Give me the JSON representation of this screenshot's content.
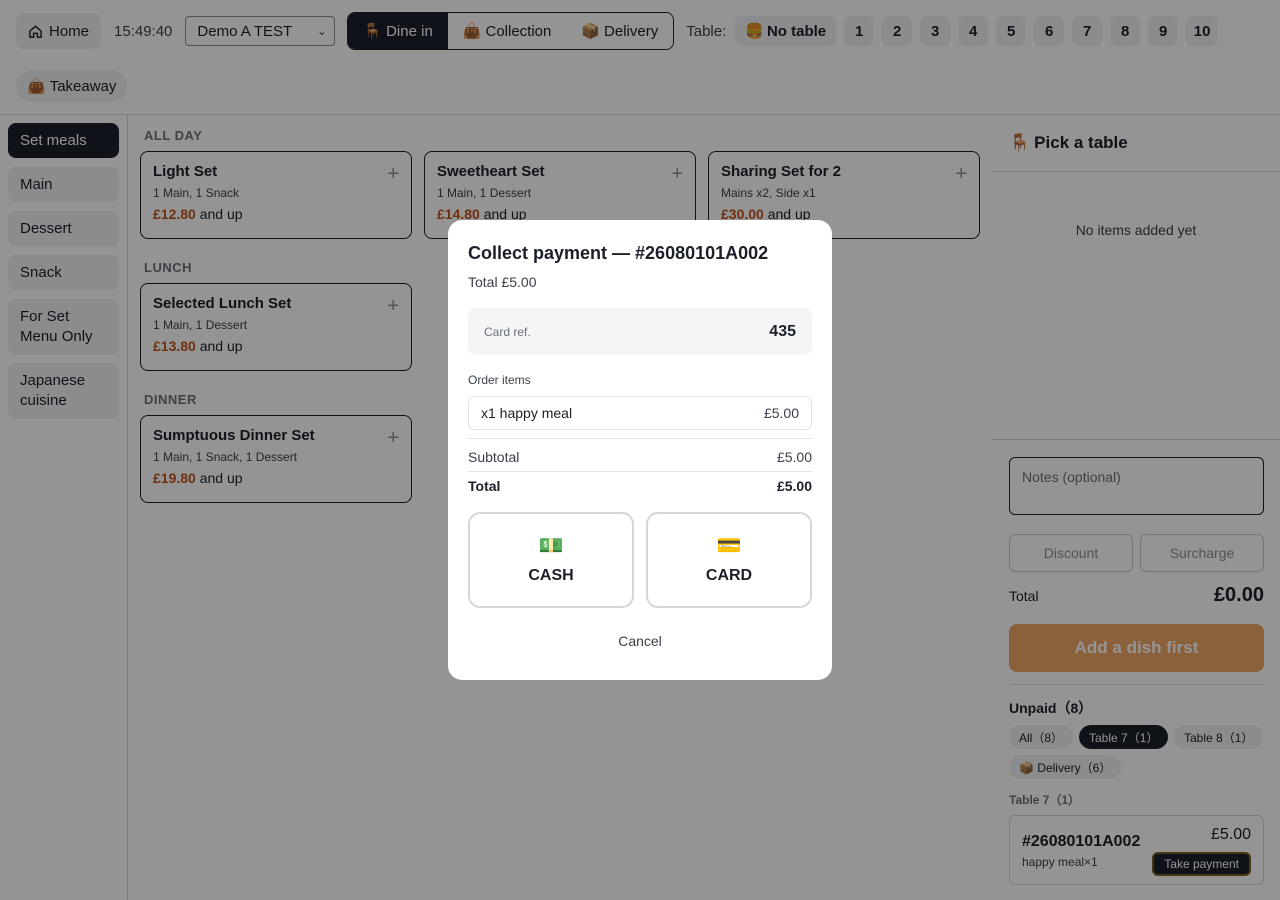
{
  "topbar": {
    "home_label": "Home",
    "time": "15:49:40",
    "store": "Demo A TEST",
    "order_types": [
      {
        "icon": "🪑",
        "label": "Dine in",
        "active": true
      },
      {
        "icon": "👜",
        "label": "Collection",
        "active": false
      },
      {
        "icon": "📦",
        "label": "Delivery",
        "active": false
      }
    ],
    "table_label": "Table:",
    "no_table": {
      "icon": "🍔",
      "label": "No table"
    },
    "tables": [
      "1",
      "2",
      "3",
      "4",
      "5",
      "6",
      "7",
      "8",
      "9",
      "10"
    ],
    "takeaway": {
      "icon": "👜",
      "label": "Takeaway"
    }
  },
  "sidebar": {
    "categories": [
      {
        "label": "Set meals",
        "active": true
      },
      {
        "label": "Main",
        "active": false
      },
      {
        "label": "Dessert",
        "active": false
      },
      {
        "label": "Snack",
        "active": false
      },
      {
        "label": "For Set Menu Only",
        "active": false
      },
      {
        "label": "Japanese cuisine",
        "active": false
      }
    ]
  },
  "menu": {
    "sections": [
      {
        "title": "ALL DAY",
        "items": [
          {
            "name": "Light Set",
            "desc": "1 Main, 1 Snack",
            "price": "£12.80",
            "suffix": "and up"
          },
          {
            "name": "Sweetheart Set",
            "desc": "1 Main, 1 Dessert",
            "price": "£14.80",
            "suffix": "and up"
          },
          {
            "name": "Sharing Set for 2",
            "desc": "Mains x2, Side x1",
            "price": "£30.00",
            "suffix": "and up"
          }
        ]
      },
      {
        "title": "LUNCH",
        "items": [
          {
            "name": "Selected Lunch Set",
            "desc": "1 Main, 1 Dessert",
            "price": "£13.80",
            "suffix": "and up"
          }
        ]
      },
      {
        "title": "DINNER",
        "items": [
          {
            "name": "Sumptuous Dinner Set",
            "desc": "1 Main, 1 Snack, 1 Dessert",
            "price": "£19.80",
            "suffix": "and up"
          }
        ]
      }
    ]
  },
  "right_panel": {
    "pick_icon": "🪑",
    "pick_title": "Pick a table",
    "empty_message": "No items added yet",
    "notes_placeholder": "Notes (optional)",
    "discount_label": "Discount",
    "surcharge_label": "Surcharge",
    "total_label": "Total",
    "total_value": "£0.00",
    "add_first_label": "Add a dish first",
    "unpaid_title": "Unpaid（8）",
    "filters": [
      {
        "label": "All（8）",
        "active": false
      },
      {
        "label": "Table 7（1）",
        "active": true
      },
      {
        "label": "Table 8（1）",
        "active": false
      },
      {
        "label": "📦 Delivery（6）",
        "active": false
      }
    ],
    "group_label": "Table 7（1）",
    "order": {
      "id": "#26080101A002",
      "items": "happy meal×1",
      "amount": "£5.00",
      "pay_label": "Take payment"
    }
  },
  "modal": {
    "title": "Collect payment — #26080101A002",
    "subtitle": "Total £5.00",
    "card_ref_label": "Card ref.",
    "card_ref_value": "435",
    "order_items_label": "Order items",
    "items": [
      {
        "name": "x1 happy meal",
        "amount": "£5.00"
      }
    ],
    "subtotal_label": "Subtotal",
    "subtotal_value": "£5.00",
    "total_label": "Total",
    "total_value": "£5.00",
    "cash": {
      "icon": "💵",
      "label": "CASH"
    },
    "card": {
      "icon": "💳",
      "label": "CARD"
    },
    "cancel_label": "Cancel"
  }
}
